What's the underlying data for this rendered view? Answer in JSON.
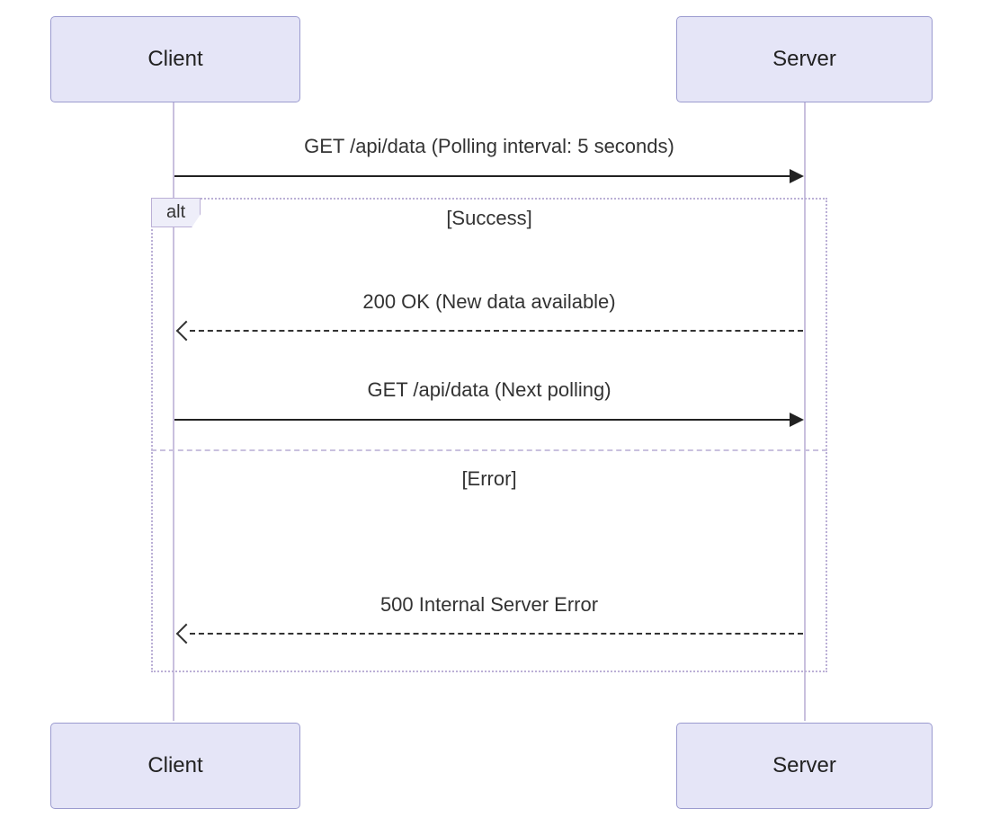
{
  "diagram": {
    "type": "sequence",
    "participants": {
      "client": "Client",
      "server": "Server"
    },
    "messages": {
      "msg1": "GET /api/data (Polling interval: 5 seconds)",
      "msg2": "200 OK (New data available)",
      "msg3": "GET /api/data (Next polling)",
      "msg4": "500 Internal Server Error"
    },
    "alt": {
      "label": "alt",
      "condition1": "[Success]",
      "condition2": "[Error]"
    }
  }
}
